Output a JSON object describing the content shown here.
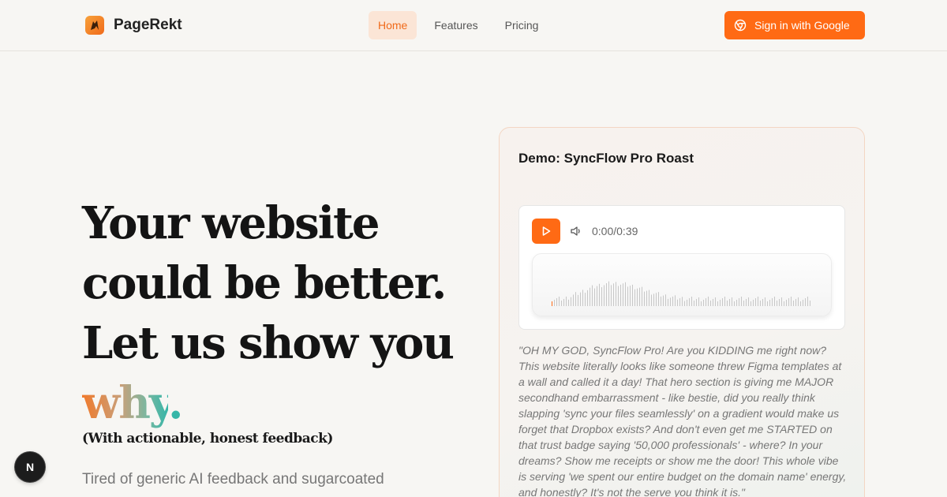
{
  "header": {
    "brand": "PageRekt",
    "nav": [
      {
        "label": "Home",
        "active": true
      },
      {
        "label": "Features",
        "active": false
      },
      {
        "label": "Pricing",
        "active": false
      }
    ],
    "signin_label": "Sign in with Google"
  },
  "hero": {
    "lines": [
      "Your website",
      "could be better.",
      "Let us show you"
    ],
    "accent_word": "why",
    "accent_punct": ".",
    "subtitle": "(With actionable, honest feedback)",
    "lead": "Tired of generic AI feedback and sugarcoated"
  },
  "demo": {
    "title": "Demo: SyncFlow Pro Roast",
    "player": {
      "time": "0:00/0:39",
      "progress": 0
    },
    "quote": "\"OH MY GOD, SyncFlow Pro! Are you KIDDING me right now? This website literally looks like someone threw Figma templates at a wall and called it a day! That hero section is giving me MAJOR secondhand embarrassment - like bestie, did you really think slapping 'sync your files seamlessly' on a gradient would make us forget that Dropbox exists? And don't even get me STARTED on that trust badge saying '50,000 professionals' - where? In your dreams? Show me receipts or show me the door! This whole vibe is serving 'we spent our entire budget on the domain name' energy, and honestly? It's not the serve you think it is.\""
  },
  "fab_label": "N",
  "colors": {
    "accent": "#ff6a14",
    "teal": "#36b6a8"
  },
  "icons": {
    "logo": "pagerekt-logo-icon",
    "signin": "chrome-icon",
    "play": "play-icon",
    "volume": "volume-icon"
  }
}
